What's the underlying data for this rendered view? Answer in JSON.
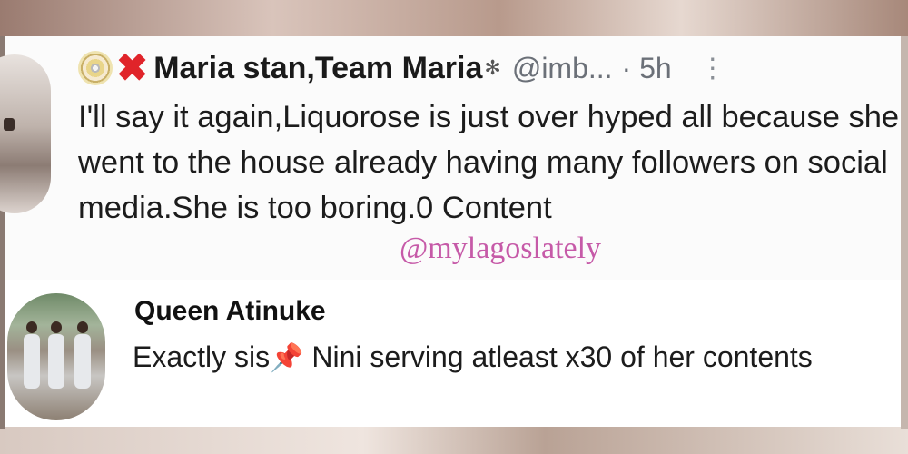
{
  "tweet": {
    "display_name": "Maria stan,Team Maria",
    "handle": "@imb...",
    "time": "· 5h",
    "text": "I'll say it again,Liquorose is just over hyped all because she went to the house already having many followers on social media.She is too boring.0 Content",
    "icons": [
      "cd-icon",
      "red-x-icon",
      "gear-icon",
      "more-icon"
    ]
  },
  "watermark": "@mylagoslately",
  "reply": {
    "name": "Queen Atinuke",
    "text_before": "Exactly sis",
    "text_after": " Nini serving atleast x30 of her contents",
    "icons": [
      "pushpin-icon"
    ]
  },
  "colors": {
    "x_red": "#e0242a",
    "watermark_pink": "#c65aa8",
    "muted_gray": "#6b7078"
  }
}
